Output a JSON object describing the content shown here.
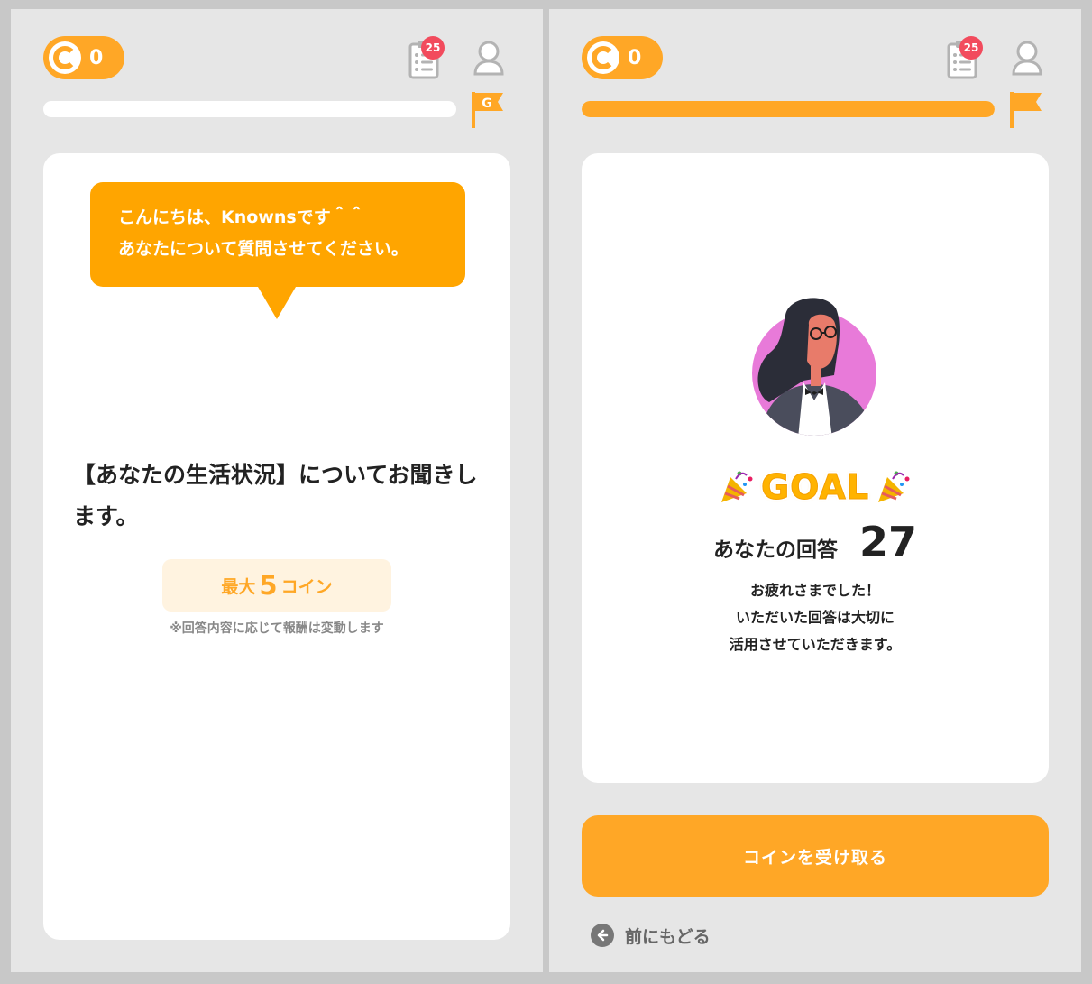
{
  "colors": {
    "accent": "#ffa726",
    "bubble": "#ffa500",
    "badge": "#f24b5d",
    "panel_bg": "#e6e6e6",
    "card_bg": "#ffffff",
    "reward_bg": "#fff3e0"
  },
  "left": {
    "header": {
      "coin_count": "0",
      "tasks_badge": "25",
      "progress_fraction": 0.0,
      "flag_icon": "goal-flag-icon",
      "flag_letter": "G"
    },
    "bubble": {
      "line1": "こんにちは、Knownsです＾＾",
      "line2": "あなたについて質問させてください。"
    },
    "question": {
      "title": "【あなたの生活状況】についてお聞きします。"
    },
    "reward": {
      "prefix": "最大",
      "amount": "5",
      "suffix": "コイン",
      "note": "※回答内容に応じて報酬は変動します"
    }
  },
  "right": {
    "header": {
      "coin_count": "0",
      "tasks_badge": "25",
      "progress_fraction": 1.0,
      "flag_icon": "flag-icon"
    },
    "result": {
      "goal_text": "GOAL",
      "answer_label": "あなたの回答",
      "answer_count": "27",
      "thanks_line1": "お疲れさまでした！",
      "thanks_line2": "いただいた回答は大切に",
      "thanks_line3": "活用させていただきます。"
    },
    "actions": {
      "receive_button": "コインを受け取る",
      "back_link": "前にもどる"
    }
  }
}
